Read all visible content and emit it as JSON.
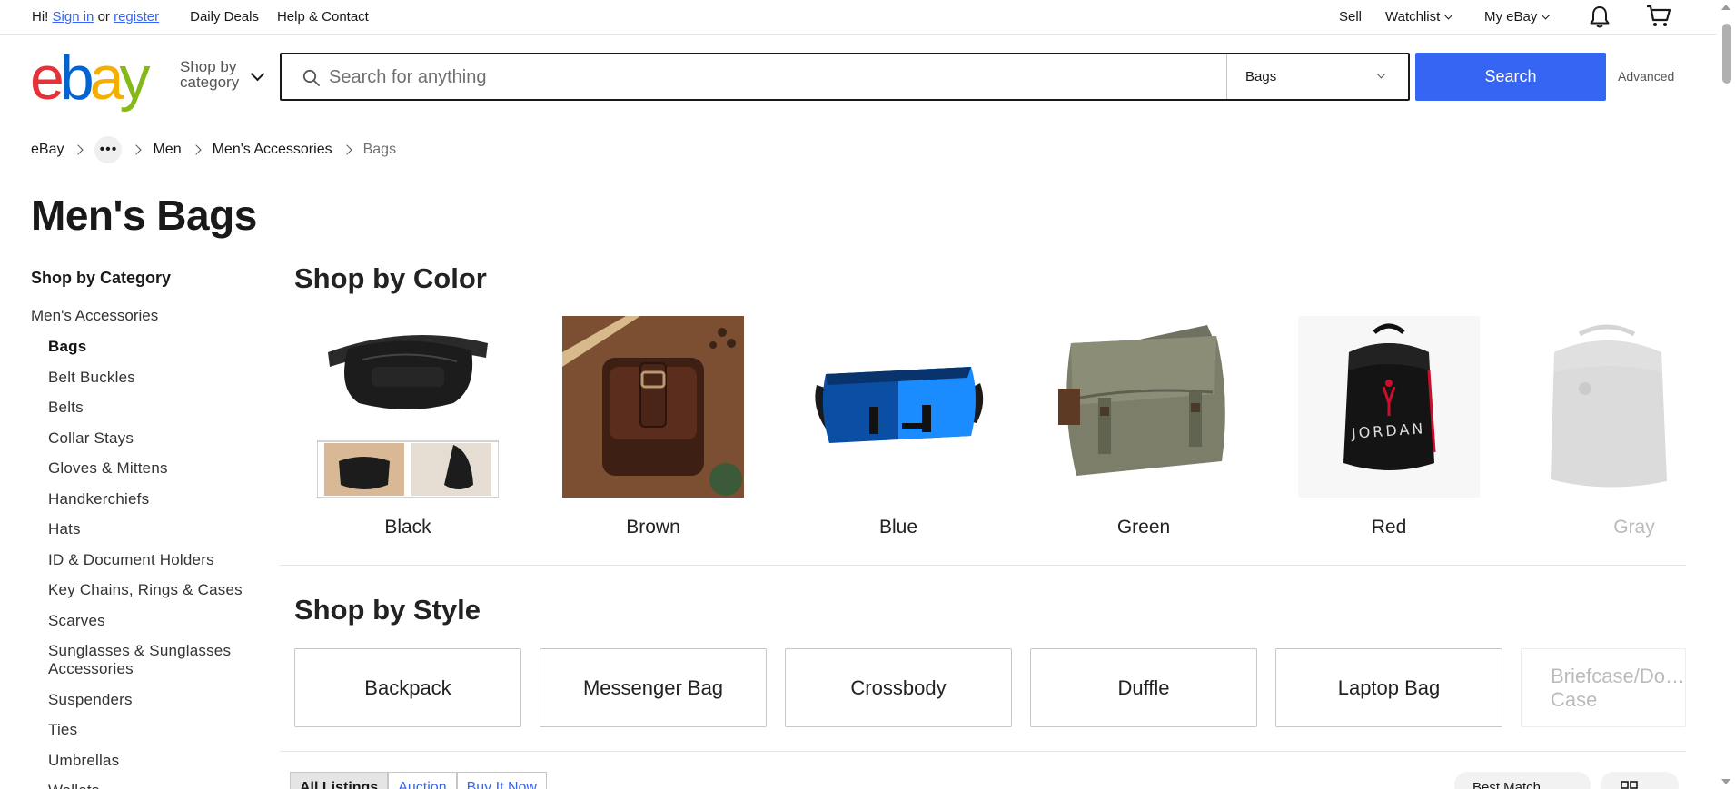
{
  "topbar": {
    "greeting": "Hi!",
    "sign_in": "Sign in",
    "or": "or",
    "register": "register",
    "daily_deals": "Daily Deals",
    "help_contact": "Help & Contact",
    "sell": "Sell",
    "watchlist": "Watchlist",
    "my_ebay": "My eBay"
  },
  "header": {
    "logo_letters": [
      "e",
      "b",
      "a",
      "y"
    ],
    "logo_colors": [
      "#e53238",
      "#0064d2",
      "#f5af02",
      "#86b817"
    ],
    "shop_by_category_line1": "Shop by",
    "shop_by_category_line2": "category",
    "search_placeholder": "Search for anything",
    "category_selected": "Bags",
    "search_button": "Search",
    "advanced": "Advanced",
    "accent_color": "#3665f3"
  },
  "breadcrumb": {
    "items": [
      "eBay",
      "Men",
      "Men's Accessories",
      "Bags"
    ],
    "overflow": "•••"
  },
  "page_title": "Men's Bags",
  "sidebar": {
    "heading": "Shop by Category",
    "parent": "Men's Accessories",
    "items": [
      "Bags",
      "Belt Buckles",
      "Belts",
      "Collar Stays",
      "Gloves & Mittens",
      "Handkerchiefs",
      "Hats",
      "ID & Document Holders",
      "Key Chains, Rings & Cases",
      "Scarves",
      "Sunglasses & Sunglasses Accessories",
      "Suspenders",
      "Ties",
      "Umbrellas",
      "Wallets"
    ],
    "active_index": 0
  },
  "shop_by_color": {
    "title": "Shop by Color",
    "items": [
      "Black",
      "Brown",
      "Blue",
      "Green",
      "Red",
      "Gray"
    ]
  },
  "shop_by_style": {
    "title": "Shop by Style",
    "items": [
      "Backpack",
      "Messenger Bag",
      "Crossbody",
      "Duffle",
      "Laptop Bag",
      "Briefcase/Do… Case"
    ]
  },
  "listing_tabs": {
    "items": [
      "All Listings",
      "Auction",
      "Buy It Now"
    ],
    "active_index": 0
  },
  "sort": {
    "label": "Best Match"
  },
  "icons": {
    "notification": "bell-icon",
    "cart": "cart-icon",
    "search": "search-icon",
    "view": "grid-view-icon"
  }
}
